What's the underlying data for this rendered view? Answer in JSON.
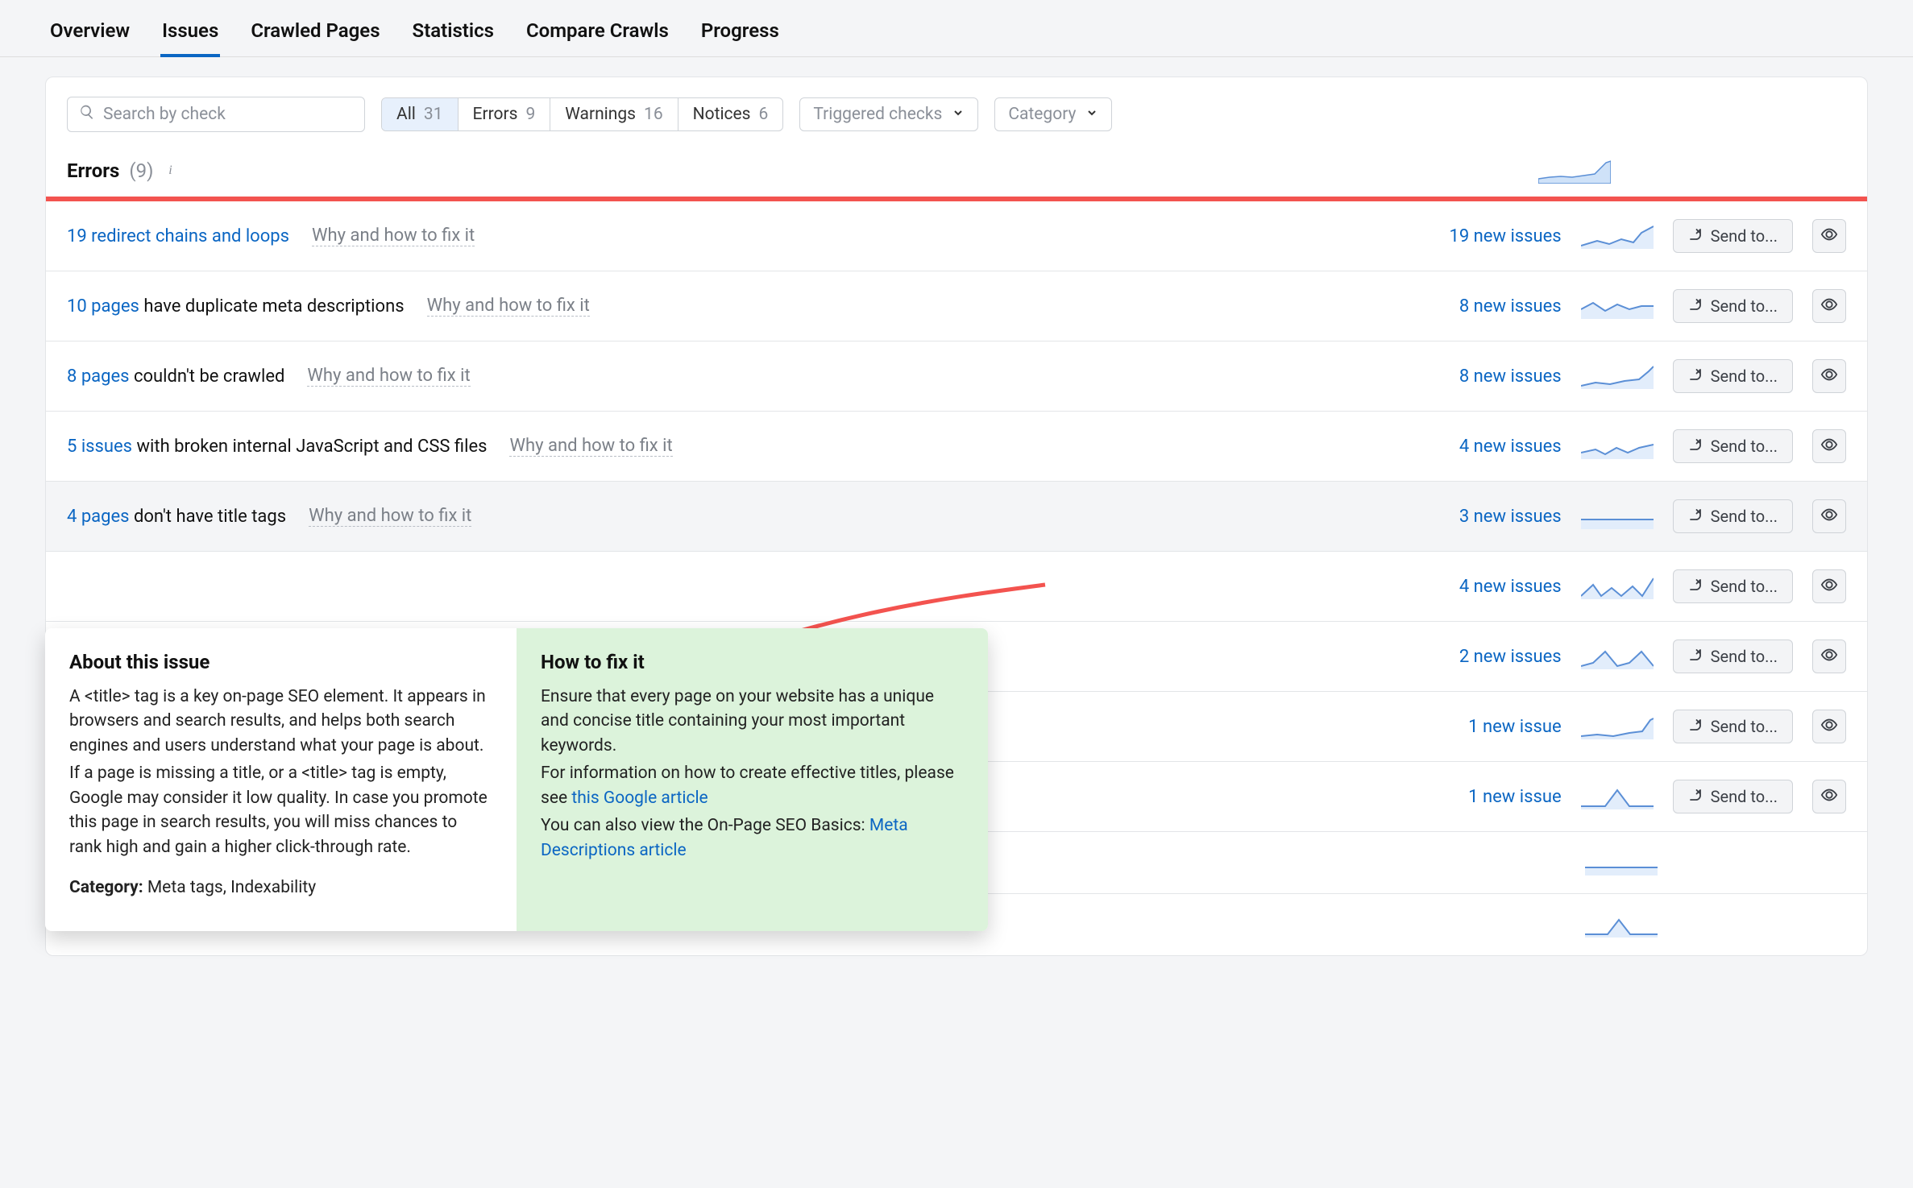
{
  "tabs": [
    "Overview",
    "Issues",
    "Crawled Pages",
    "Statistics",
    "Compare Crawls",
    "Progress"
  ],
  "activeTab": 1,
  "search": {
    "placeholder": "Search by check"
  },
  "segments": [
    {
      "label": "All",
      "count": "31",
      "active": true
    },
    {
      "label": "Errors",
      "count": "9"
    },
    {
      "label": "Warnings",
      "count": "16"
    },
    {
      "label": "Notices",
      "count": "6"
    }
  ],
  "dropdowns": {
    "triggered": "Triggered checks",
    "category": "Category"
  },
  "section": {
    "title": "Errors",
    "count": "(9)"
  },
  "whyLabel": "Why and how to fix it",
  "sendLabel": "Send to...",
  "rows": [
    {
      "num": "19",
      "unit": "redirect chains and loops",
      "linkStyle": "full",
      "new": "19 new issues"
    },
    {
      "num": "10 pages",
      "rest": " have duplicate meta descriptions",
      "new": "8 new issues"
    },
    {
      "num": "8 pages",
      "rest": " couldn't be crawled",
      "new": "8 new issues"
    },
    {
      "num": "5 issues",
      "rest": " with broken internal JavaScript and CSS files",
      "new": "4 new issues"
    },
    {
      "num": "4 pages",
      "rest": " don't have title tags",
      "new": "3 new issues",
      "hl": true
    },
    {
      "num": "",
      "rest": "",
      "new": "4 new issues"
    },
    {
      "num": "",
      "rest": "",
      "new": "2 new issues"
    },
    {
      "num": "",
      "rest": "",
      "new": "1 new issue"
    },
    {
      "num": "",
      "rest": "",
      "new": "1 new issue"
    },
    {
      "num": "",
      "rest": "",
      "new": ""
    },
    {
      "num": "",
      "rest": "",
      "new": ""
    }
  ],
  "popover": {
    "aboutTitle": "About this issue",
    "aboutP1": "A <title> tag is a key on-page SEO element. It appears in browsers and search results, and helps both search engines and users understand what your page is about.",
    "aboutP2": "If a page is missing a title, or a <title> tag is empty, Google may consider it low quality. In case you promote this page in search results, you will miss chances to rank high and gain a higher click-through rate.",
    "catLabel": "Category:",
    "catValue": " Meta tags, Indexability",
    "fixTitle": "How to fix it",
    "fixP1": "Ensure that every page on your website has a unique and concise title containing your most important keywords.",
    "fixP2a": "For information on how to create effective titles, please see ",
    "fixLink1": "this Google article",
    "fixP3a": "You can also view the On-Page SEO Basics: ",
    "fixLink2": "Meta Descriptions article"
  },
  "sparkPaths": [
    "M0,26 L14,24 L28,23 L42,24 L56,22 L70,20 L84,6 L90,4",
    "M0,28 L20,22 L35,26 L50,20 L65,24 L75,12 L90,4",
    "M0,20 L15,12 L30,22 L45,14 L60,20 L75,16 L90,16",
    "M0,28 L18,24 L36,26 L54,22 L72,20 L84,10 L90,4",
    "M0,24 L18,20 L30,26 L44,18 L58,24 L72,18 L90,14",
    "M0,20 L90,20",
    "M0,28 L15,14 L25,28 L38,18 L50,28 L64,16 L76,28 L90,6",
    "M0,28 L15,24 L30,10 L45,28 L60,24 L75,10 L90,28",
    "M0,28 L20,26 L40,28 L60,24 L76,22 L86,8 L90,6",
    "M0,28 L30,28 L45,8 L60,28 L90,28",
    "M0,22 L90,22",
    "M0,28 L28,28 L42,10 L56,28 L90,28"
  ]
}
